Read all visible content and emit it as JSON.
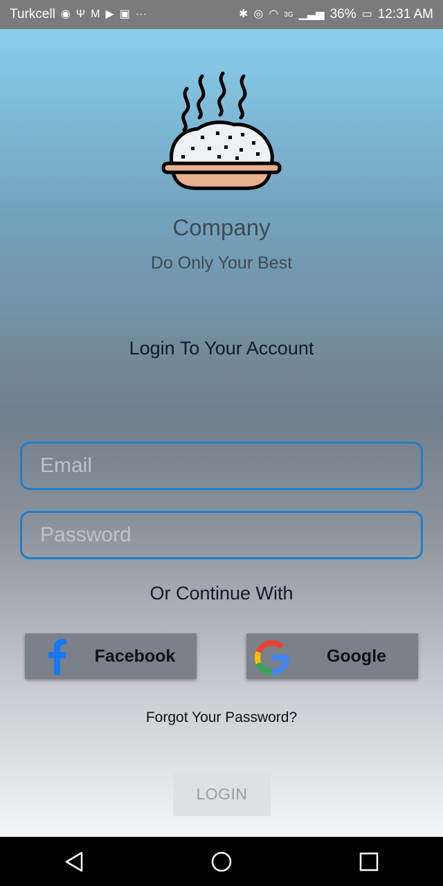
{
  "status_bar": {
    "carrier": "Turkcell",
    "network": "3G",
    "battery": "36%",
    "time": "12:31 AM",
    "left_icons": [
      "spotify-icon",
      "usb-icon",
      "gmail-icon",
      "youtube-icon",
      "notification-icon",
      "more-icon"
    ],
    "right_icons": [
      "bluetooth-icon",
      "eye-icon",
      "wifi-icon",
      "signal-icon",
      "battery-icon"
    ]
  },
  "app": {
    "company_name": "Company",
    "tagline": "Do Only Your Best",
    "login_heading": "Login To Your Account",
    "email_placeholder": "Email",
    "password_placeholder": "Password",
    "continue_label": "Or Continue With",
    "facebook_label": "Facebook",
    "google_label": "Google",
    "forgot_password": "Forgot Your Password?",
    "login_button": "LOGIN"
  },
  "colors": {
    "field_border": "#1e7ec9",
    "social_button": "#7a8189",
    "facebook": "#1877f2"
  }
}
